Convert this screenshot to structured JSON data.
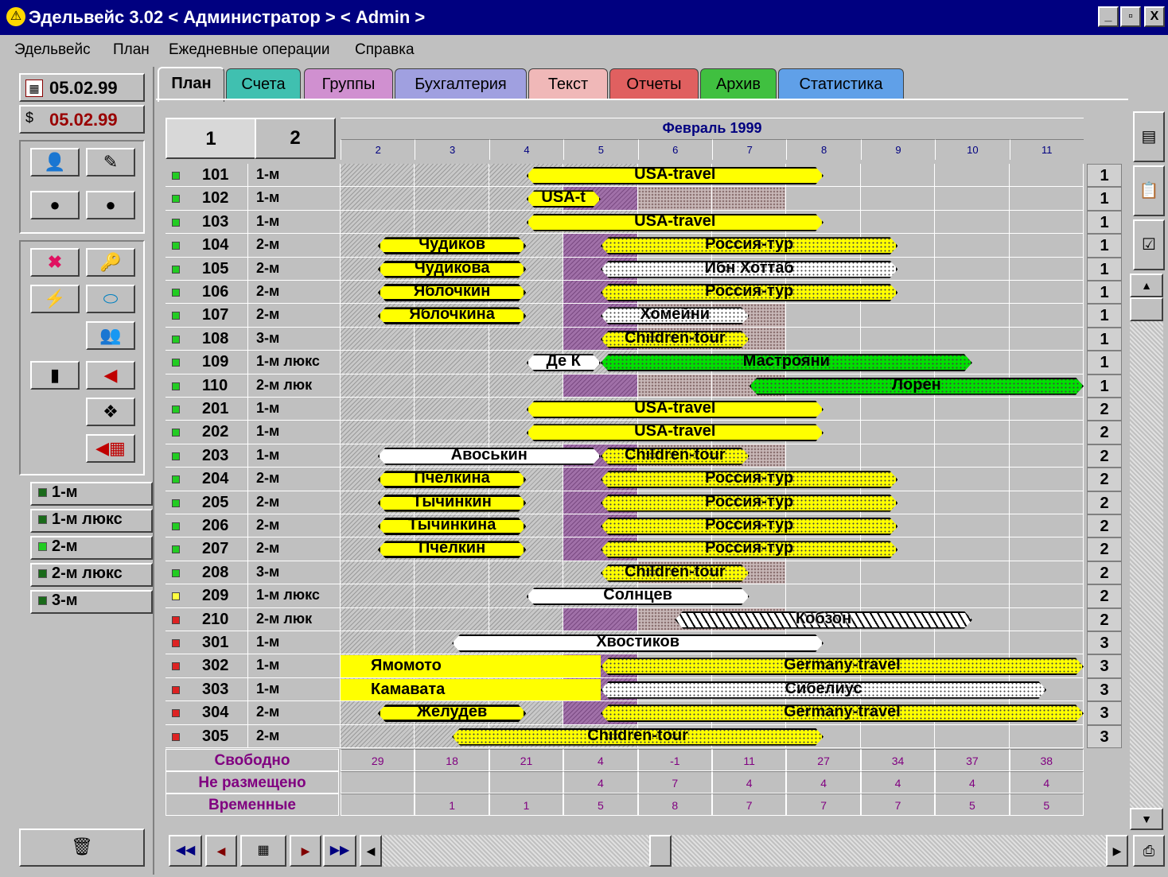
{
  "window": {
    "title": "Эдельвейс 3.02 < Администратор > < Admin >",
    "controls": [
      "_",
      "▫",
      "X"
    ]
  },
  "menu": [
    "Эдельвейс",
    "План",
    "Ежедневные операции",
    "Справка"
  ],
  "dates": {
    "date1": "05.02.99",
    "date2": "05.02.99"
  },
  "categories": [
    {
      "label": "1-м",
      "led": "#1a6a1a"
    },
    {
      "label": "1-м люкс",
      "led": "#1a6a1a"
    },
    {
      "label": "2-м",
      "led": "#22cc22"
    },
    {
      "label": "2-м люкс",
      "led": "#1a6a1a"
    },
    {
      "label": "3-м",
      "led": "#1a6a1a"
    }
  ],
  "tabs": [
    {
      "label": "План",
      "color": "#c0c0c0"
    },
    {
      "label": "Счета",
      "color": "#40c0b0"
    },
    {
      "label": "Группы",
      "color": "#d090d0"
    },
    {
      "label": "Бухгалтерия",
      "color": "#a0a0e0"
    },
    {
      "label": "Текст",
      "color": "#f0b8b8"
    },
    {
      "label": "Отчеты",
      "color": "#e06060"
    },
    {
      "label": "Архив",
      "color": "#40c040"
    },
    {
      "label": "Статистика",
      "color": "#60a0e8"
    }
  ],
  "subtabs": [
    "1",
    "2"
  ],
  "calendar": {
    "month": "Февраль 1999",
    "days": [
      "2",
      "3",
      "4",
      "5",
      "6",
      "7",
      "8",
      "9",
      "10",
      "11"
    ]
  },
  "rooms": [
    {
      "num": "101",
      "type": "1-м",
      "floor": "1",
      "led": "#22cc22"
    },
    {
      "num": "102",
      "type": "1-м",
      "floor": "1",
      "led": "#22cc22"
    },
    {
      "num": "103",
      "type": "1-м",
      "floor": "1",
      "led": "#22cc22"
    },
    {
      "num": "104",
      "type": "2-м",
      "floor": "1",
      "led": "#22cc22"
    },
    {
      "num": "105",
      "type": "2-м",
      "floor": "1",
      "led": "#22cc22"
    },
    {
      "num": "106",
      "type": "2-м",
      "floor": "1",
      "led": "#22cc22"
    },
    {
      "num": "107",
      "type": "2-м",
      "floor": "1",
      "led": "#22cc22"
    },
    {
      "num": "108",
      "type": "3-м",
      "floor": "1",
      "led": "#22cc22"
    },
    {
      "num": "109",
      "type": "1-м люкс",
      "floor": "1",
      "led": "#22cc22"
    },
    {
      "num": "110",
      "type": "2-м люк",
      "floor": "1",
      "led": "#22cc22"
    },
    {
      "num": "201",
      "type": "1-м",
      "floor": "2",
      "led": "#22cc22"
    },
    {
      "num": "202",
      "type": "1-м",
      "floor": "2",
      "led": "#22cc22"
    },
    {
      "num": "203",
      "type": "1-м",
      "floor": "2",
      "led": "#22cc22"
    },
    {
      "num": "204",
      "type": "2-м",
      "floor": "2",
      "led": "#22cc22"
    },
    {
      "num": "205",
      "type": "2-м",
      "floor": "2",
      "led": "#22cc22"
    },
    {
      "num": "206",
      "type": "2-м",
      "floor": "2",
      "led": "#22cc22"
    },
    {
      "num": "207",
      "type": "2-м",
      "floor": "2",
      "led": "#22cc22"
    },
    {
      "num": "208",
      "type": "3-м",
      "floor": "2",
      "led": "#22cc22"
    },
    {
      "num": "209",
      "type": "1-м люкс",
      "floor": "2",
      "led": "#ffff40"
    },
    {
      "num": "210",
      "type": "2-м люк",
      "floor": "2",
      "led": "#dd2222"
    },
    {
      "num": "301",
      "type": "1-м",
      "floor": "3",
      "led": "#dd2222"
    },
    {
      "num": "302",
      "type": "1-м",
      "floor": "3",
      "led": "#dd2222"
    },
    {
      "num": "303",
      "type": "1-м",
      "floor": "3",
      "led": "#dd2222"
    },
    {
      "num": "304",
      "type": "2-м",
      "floor": "3",
      "led": "#dd2222"
    },
    {
      "num": "305",
      "type": "2-м",
      "floor": "3",
      "led": "#dd2222"
    }
  ],
  "bookings": [
    {
      "row": 0,
      "start": 2.5,
      "end": 6.5,
      "label": "USA-travel",
      "style": "yellow"
    },
    {
      "row": 1,
      "start": 2.5,
      "end": 3.5,
      "label": "USA-t",
      "style": "yellow"
    },
    {
      "row": 2,
      "start": 2.5,
      "end": 6.5,
      "label": "USA-travel",
      "style": "yellow"
    },
    {
      "row": 3,
      "start": 0.5,
      "end": 2.5,
      "label": "Чудиков",
      "style": "yellow-thick"
    },
    {
      "row": 3,
      "start": 3.5,
      "end": 7.5,
      "label": "Россия-тур",
      "style": "yellow-dot"
    },
    {
      "row": 4,
      "start": 0.5,
      "end": 2.5,
      "label": "Чудикова",
      "style": "yellow-thick"
    },
    {
      "row": 4,
      "start": 3.5,
      "end": 7.5,
      "label": "Ибн Хоттаб",
      "style": "white-dot"
    },
    {
      "row": 5,
      "start": 0.5,
      "end": 2.5,
      "label": "Яблочкин",
      "style": "yellow-thick"
    },
    {
      "row": 5,
      "start": 3.5,
      "end": 7.5,
      "label": "Россия-тур",
      "style": "yellow-dot"
    },
    {
      "row": 6,
      "start": 0.5,
      "end": 2.5,
      "label": "Яблочкина",
      "style": "yellow-thick"
    },
    {
      "row": 6,
      "start": 3.5,
      "end": 5.5,
      "label": "Хомейни",
      "style": "white-dot"
    },
    {
      "row": 7,
      "start": 3.5,
      "end": 5.5,
      "label": "Children-tour",
      "style": "yellow-dot"
    },
    {
      "row": 8,
      "start": 2.5,
      "end": 3.5,
      "label": "Де К",
      "style": "white"
    },
    {
      "row": 8,
      "start": 3.5,
      "end": 8.5,
      "label": "Мастрояни",
      "style": "green"
    },
    {
      "row": 9,
      "start": 5.5,
      "end": 10,
      "label": "Лорен",
      "style": "green"
    },
    {
      "row": 10,
      "start": 2.5,
      "end": 6.5,
      "label": "USA-travel",
      "style": "yellow"
    },
    {
      "row": 11,
      "start": 2.5,
      "end": 6.5,
      "label": "USA-travel",
      "style": "yellow"
    },
    {
      "row": 12,
      "start": 0.5,
      "end": 3.5,
      "label": "Авоськин",
      "style": "white"
    },
    {
      "row": 12,
      "start": 3.5,
      "end": 5.5,
      "label": "Children-tour",
      "style": "yellow-dot"
    },
    {
      "row": 13,
      "start": 0.5,
      "end": 2.5,
      "label": "Пчелкина",
      "style": "yellow-thick"
    },
    {
      "row": 13,
      "start": 3.5,
      "end": 7.5,
      "label": "Россия-тур",
      "style": "yellow-dot"
    },
    {
      "row": 14,
      "start": 0.5,
      "end": 2.5,
      "label": "Тычинкин",
      "style": "yellow-thick"
    },
    {
      "row": 14,
      "start": 3.5,
      "end": 7.5,
      "label": "Россия-тур",
      "style": "yellow-dot"
    },
    {
      "row": 15,
      "start": 0.5,
      "end": 2.5,
      "label": "Тычинкина",
      "style": "yellow-thick"
    },
    {
      "row": 15,
      "start": 3.5,
      "end": 7.5,
      "label": "Россия-тур",
      "style": "yellow-dot"
    },
    {
      "row": 16,
      "start": 0.5,
      "end": 2.5,
      "label": "Пчелкин",
      "style": "yellow-thick"
    },
    {
      "row": 16,
      "start": 3.5,
      "end": 7.5,
      "label": "Россия-тур",
      "style": "yellow-dot"
    },
    {
      "row": 17,
      "start": 3.5,
      "end": 5.5,
      "label": "Children-tour",
      "style": "yellow-dot"
    },
    {
      "row": 18,
      "start": 2.5,
      "end": 5.5,
      "label": "Солнцев",
      "style": "white"
    },
    {
      "row": 19,
      "start": 4.5,
      "end": 8.5,
      "label": "Кобзон",
      "style": "stripe"
    },
    {
      "row": 20,
      "start": 1.5,
      "end": 6.5,
      "label": "Хвостиков",
      "style": "white"
    },
    {
      "row": 21,
      "start": 0,
      "end": 3.5,
      "label": "Ямомото",
      "style": "yellow-flat"
    },
    {
      "row": 21,
      "start": 3.5,
      "end": 10,
      "label": "Germany-travel",
      "style": "yellow-dot"
    },
    {
      "row": 22,
      "start": 0,
      "end": 3.5,
      "label": "Камавата",
      "style": "yellow-flat"
    },
    {
      "row": 22,
      "start": 3.5,
      "end": 9.5,
      "label": "Сибелиус",
      "style": "white-dot"
    },
    {
      "row": 23,
      "start": 0.5,
      "end": 2.5,
      "label": "Желудев",
      "style": "yellow-thick"
    },
    {
      "row": 23,
      "start": 3.5,
      "end": 10,
      "label": "Germany-travel",
      "style": "yellow-dot"
    },
    {
      "row": 24,
      "start": 1.5,
      "end": 6.5,
      "label": "Children-tour",
      "style": "yellow-dot"
    }
  ],
  "stats": [
    {
      "label": "Свободно",
      "values": [
        "29",
        "18",
        "21",
        "4",
        "-1",
        "11",
        "27",
        "34",
        "37",
        "38"
      ]
    },
    {
      "label": "Не размещено",
      "values": [
        "",
        "",
        "",
        "4",
        "7",
        "4",
        "4",
        "4",
        "4",
        "4"
      ]
    },
    {
      "label": "Временные",
      "values": [
        "",
        "1",
        "1",
        "5",
        "8",
        "7",
        "7",
        "7",
        "5",
        "5"
      ]
    }
  ],
  "colors": {
    "yellow": "#ffff00",
    "green": "#00e000",
    "titlebar": "#000080",
    "stat_text": "#800080"
  }
}
